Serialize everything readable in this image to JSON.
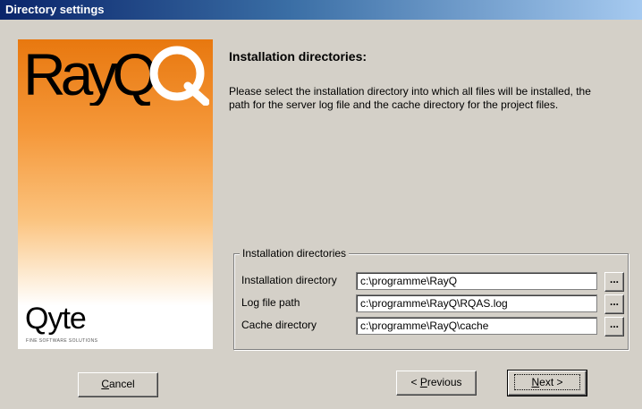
{
  "window": {
    "title": "Directory settings"
  },
  "branding": {
    "product_logo": "RayQ",
    "company_logo": "Qyte",
    "company_tagline": "FINE SOFTWARE SOLUTIONS"
  },
  "main": {
    "heading": "Installation directories:",
    "description": "Please select the installation directory into which all files will be installed, the path for the server log file and the cache directory for the project files."
  },
  "group": {
    "legend": "Installation directories",
    "fields": [
      {
        "label": "Installation directory",
        "value": "c:\\programme\\RayQ",
        "browse_label": "..."
      },
      {
        "label": "Log file path",
        "value": "c:\\programme\\RayQ\\RQAS.log",
        "browse_label": "..."
      },
      {
        "label": "Cache directory",
        "value": "c:\\programme\\RayQ\\cache",
        "browse_label": "..."
      }
    ]
  },
  "buttons": {
    "cancel": {
      "mnemonic": "C",
      "rest": "ancel"
    },
    "previous": {
      "prefix": "< ",
      "mnemonic": "P",
      "rest": "revious"
    },
    "next": {
      "mnemonic": "N",
      "rest": "ext >"
    }
  },
  "colors": {
    "title_bar_start": "#0a246a",
    "title_bar_end": "#a6caf0",
    "banner_orange": "#e8780f",
    "dialog_face": "#d4d0c8"
  }
}
